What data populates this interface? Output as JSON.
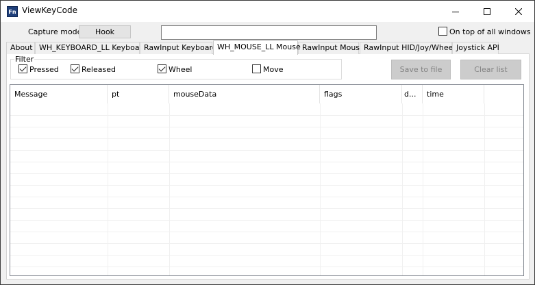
{
  "window": {
    "title": "ViewKeyCode",
    "icon_text": "Fn",
    "controls": [
      "minimize-icon",
      "maximize-icon",
      "close-icon"
    ]
  },
  "top": {
    "capture_mode_label": "Capture mode",
    "capture_mode_value": "Hook",
    "capture_input_value": "",
    "on_top_label": "On top of all windows",
    "on_top_checked": false
  },
  "tabs": [
    {
      "label": "About",
      "active": false
    },
    {
      "label": "WH_KEYBOARD_LL Keyboard",
      "active": false
    },
    {
      "label": "RawInput Keyboard",
      "active": false
    },
    {
      "label": "WH_MOUSE_LL Mouse",
      "active": true
    },
    {
      "label": "RawInput Mouse",
      "active": false
    },
    {
      "label": "RawInput HID/Joy/Wheel",
      "active": false
    },
    {
      "label": "Joystick API",
      "active": false
    }
  ],
  "filter": {
    "title": "Filter",
    "items": [
      {
        "label": "Pressed",
        "checked": true
      },
      {
        "label": "Released",
        "checked": true
      },
      {
        "label": "Wheel",
        "checked": true
      },
      {
        "label": "Move",
        "checked": false
      }
    ]
  },
  "buttons": {
    "save": "Save to file",
    "clear": "Clear list",
    "enabled": false
  },
  "table": {
    "columns": [
      "Message",
      "pt",
      "mouseData",
      "flags",
      "d...",
      "time"
    ],
    "rows": []
  }
}
